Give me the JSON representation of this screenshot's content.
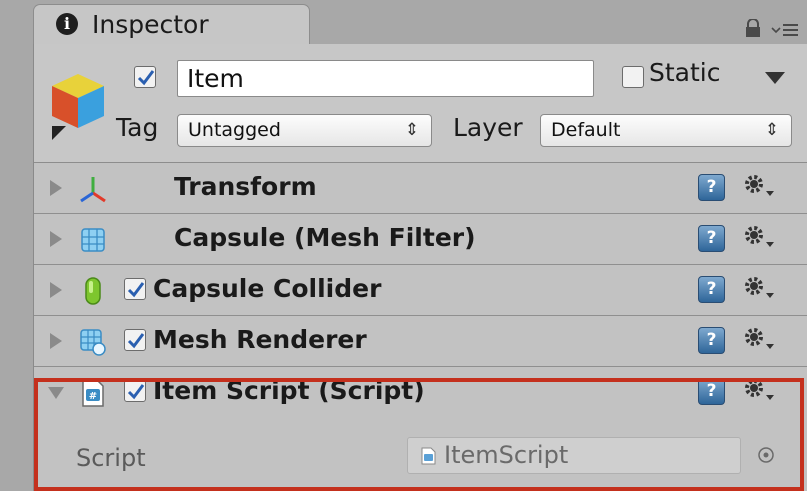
{
  "tab": {
    "title": "Inspector",
    "info_icon": "info-icon"
  },
  "game_object": {
    "active": true,
    "name": "Item",
    "static_label": "Static",
    "static": false,
    "tag_label": "Tag",
    "tag_value": "Untagged",
    "layer_label": "Layer",
    "layer_value": "Default",
    "icon": "cube-icon"
  },
  "components": [
    {
      "title": "Transform",
      "icon": "transform-icon",
      "has_checkbox": false,
      "expanded": false
    },
    {
      "title": "Capsule (Mesh Filter)",
      "icon": "mesh-filter-icon",
      "has_checkbox": false,
      "expanded": false
    },
    {
      "title": "Capsule Collider",
      "icon": "capsule-collider-icon",
      "has_checkbox": true,
      "enabled": true,
      "expanded": false
    },
    {
      "title": "Mesh Renderer",
      "icon": "mesh-renderer-icon",
      "has_checkbox": true,
      "enabled": true,
      "expanded": false
    },
    {
      "title": "Item Script (Script)",
      "icon": "csharp-script-icon",
      "has_checkbox": true,
      "enabled": true,
      "expanded": true
    }
  ],
  "script_field": {
    "label": "Script",
    "value": "ItemScript"
  },
  "help_icon_glyph": "?",
  "colors": {
    "highlight": "#c4301d",
    "help_blue": "#2e6599",
    "panel": "#c2c2c2"
  }
}
